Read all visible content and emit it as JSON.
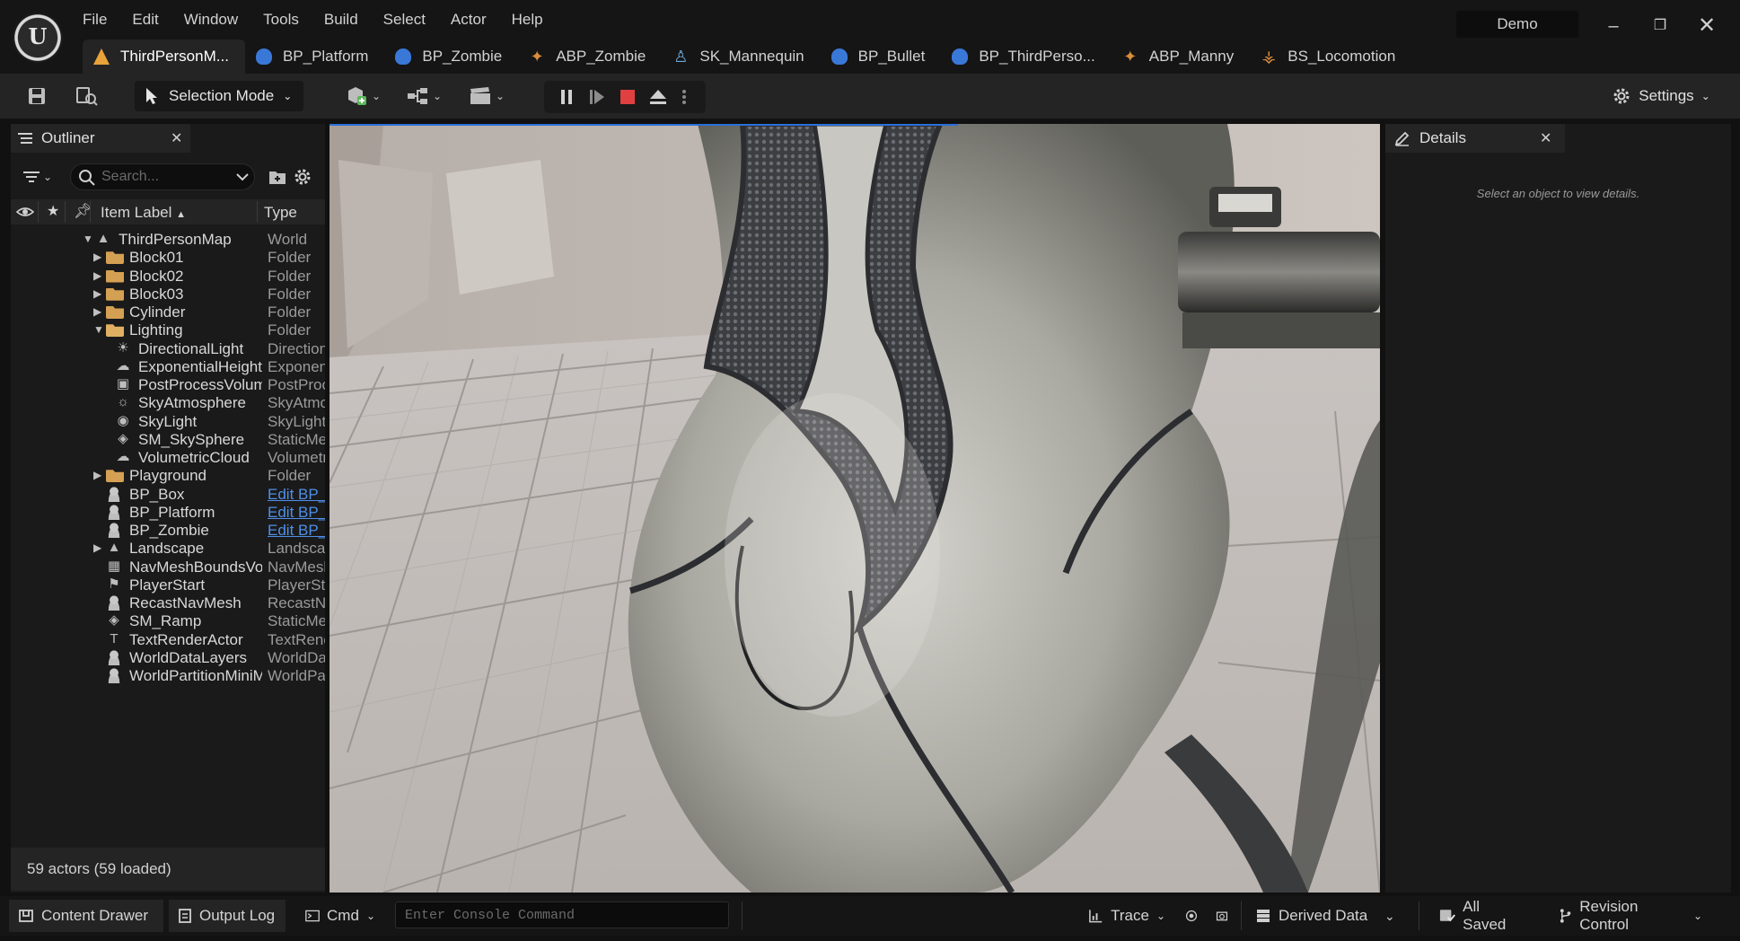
{
  "menu": [
    "File",
    "Edit",
    "Window",
    "Tools",
    "Build",
    "Select",
    "Actor",
    "Help"
  ],
  "project_name": "Demo",
  "tabs": [
    {
      "label": "ThirdPersonM...",
      "icon": "map-icon",
      "active": true
    },
    {
      "label": "BP_Platform",
      "icon": "blueprint-icon",
      "active": false
    },
    {
      "label": "BP_Zombie",
      "icon": "blueprint-icon",
      "active": false
    },
    {
      "label": "ABP_Zombie",
      "icon": "anim-blueprint-icon",
      "active": false
    },
    {
      "label": "SK_Mannequin",
      "icon": "skeleton-icon",
      "active": false
    },
    {
      "label": "BP_Bullet",
      "icon": "blueprint-icon",
      "active": false
    },
    {
      "label": "BP_ThirdPerso...",
      "icon": "blueprint-icon",
      "active": false
    },
    {
      "label": "ABP_Manny",
      "icon": "anim-blueprint-icon",
      "active": false
    },
    {
      "label": "BS_Locomotion",
      "icon": "blendspace-icon",
      "active": false
    }
  ],
  "toolbar": {
    "mode_label": "Selection Mode",
    "settings_label": "Settings"
  },
  "outliner": {
    "title": "Outliner",
    "search_placeholder": "Search...",
    "col_label": "Item Label",
    "col_type": "Type",
    "footer": "59 actors (59 loaded)",
    "rows": [
      {
        "label": "ThirdPersonMap",
        "type": "World",
        "depth": 0,
        "expand": "open",
        "icon": "map-icon"
      },
      {
        "label": "Block01",
        "type": "Folder",
        "depth": 1,
        "expand": "closed",
        "icon": "folder-icon"
      },
      {
        "label": "Block02",
        "type": "Folder",
        "depth": 1,
        "expand": "closed",
        "icon": "folder-icon"
      },
      {
        "label": "Block03",
        "type": "Folder",
        "depth": 1,
        "expand": "closed",
        "icon": "folder-icon"
      },
      {
        "label": "Cylinder",
        "type": "Folder",
        "depth": 1,
        "expand": "closed",
        "icon": "folder-icon"
      },
      {
        "label": "Lighting",
        "type": "Folder",
        "depth": 1,
        "expand": "open",
        "icon": "folder-open-icon"
      },
      {
        "label": "DirectionalLight",
        "type": "DirectionalLight",
        "depth": 2,
        "expand": "none",
        "icon": "directional-light-icon"
      },
      {
        "label": "ExponentialHeightFog",
        "type": "ExponentialHeightFog",
        "depth": 2,
        "expand": "none",
        "icon": "fog-icon"
      },
      {
        "label": "PostProcessVolume",
        "type": "PostProcessVolume",
        "depth": 2,
        "expand": "none",
        "icon": "postprocess-icon"
      },
      {
        "label": "SkyAtmosphere",
        "type": "SkyAtmosphere",
        "depth": 2,
        "expand": "none",
        "icon": "sky-atmosphere-icon"
      },
      {
        "label": "SkyLight",
        "type": "SkyLight",
        "depth": 2,
        "expand": "none",
        "icon": "skylight-icon"
      },
      {
        "label": "SM_SkySphere",
        "type": "StaticMeshActor",
        "depth": 2,
        "expand": "none",
        "icon": "static-mesh-icon"
      },
      {
        "label": "VolumetricCloud",
        "type": "VolumetricCloud",
        "depth": 2,
        "expand": "none",
        "icon": "cloud-icon"
      },
      {
        "label": "Playground",
        "type": "Folder",
        "depth": 1,
        "expand": "closed",
        "icon": "folder-icon"
      },
      {
        "label": "BP_Box",
        "type": "Edit BP_Box",
        "depth": 1,
        "expand": "none",
        "icon": "actor-icon",
        "link": true
      },
      {
        "label": "BP_Platform",
        "type": "Edit BP_Platform",
        "depth": 1,
        "expand": "none",
        "icon": "actor-icon",
        "link": true
      },
      {
        "label": "BP_Zombie",
        "type": "Edit BP_Zombie",
        "depth": 1,
        "expand": "none",
        "icon": "actor-icon",
        "link": true
      },
      {
        "label": "Landscape",
        "type": "Landscape",
        "depth": 1,
        "expand": "closed",
        "icon": "landscape-icon"
      },
      {
        "label": "NavMeshBoundsVolume",
        "type": "NavMeshBoundsVolume",
        "depth": 1,
        "expand": "none",
        "icon": "navmesh-icon"
      },
      {
        "label": "PlayerStart",
        "type": "PlayerStart",
        "depth": 1,
        "expand": "none",
        "icon": "player-start-icon"
      },
      {
        "label": "RecastNavMesh",
        "type": "RecastNavMesh",
        "depth": 1,
        "expand": "none",
        "icon": "actor-icon"
      },
      {
        "label": "SM_Ramp",
        "type": "StaticMeshActor",
        "depth": 1,
        "expand": "none",
        "icon": "static-mesh-icon"
      },
      {
        "label": "TextRenderActor",
        "type": "TextRenderActor",
        "depth": 1,
        "expand": "none",
        "icon": "text-render-icon"
      },
      {
        "label": "WorldDataLayers",
        "type": "WorldDataLayers",
        "depth": 1,
        "expand": "none",
        "icon": "actor-icon"
      },
      {
        "label": "WorldPartitionMiniMap",
        "type": "WorldPartitionMiniMap",
        "depth": 1,
        "expand": "none",
        "icon": "actor-icon"
      }
    ]
  },
  "details": {
    "title": "Details",
    "empty_message": "Select an object to view details."
  },
  "statusbar": {
    "content_drawer": "Content Drawer",
    "output_log": "Output Log",
    "cmd": "Cmd",
    "console_placeholder": "Enter Console Command",
    "trace": "Trace",
    "derived_data": "Derived Data",
    "all_saved": "All Saved",
    "revision_control": "Revision Control"
  },
  "colors": {
    "accent": "#2a6fd8",
    "stop_button": "#e04040",
    "folder": "#d4a053",
    "link": "#4f8fe8"
  }
}
